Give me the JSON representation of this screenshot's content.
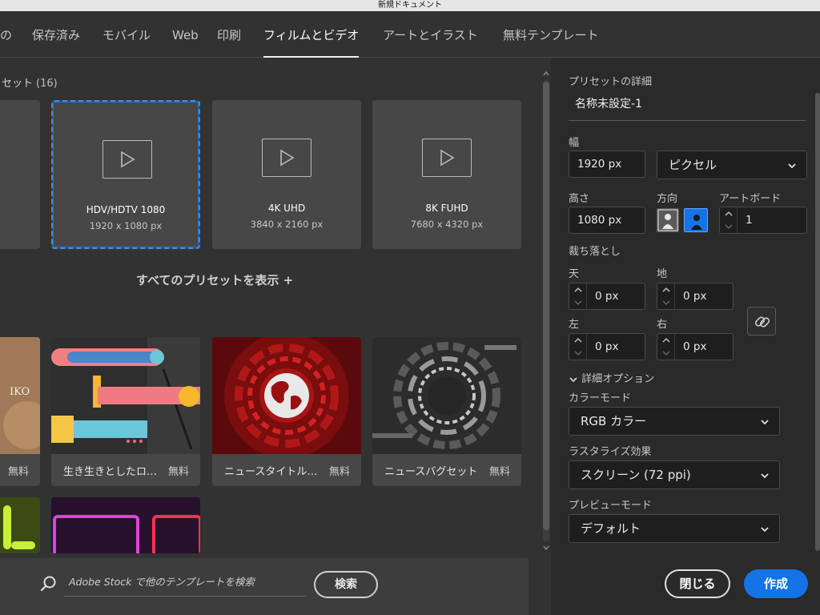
{
  "window": {
    "title": "新規ドキュメント"
  },
  "tabs": [
    {
      "label": "の"
    },
    {
      "label": "保存済み"
    },
    {
      "label": "モバイル"
    },
    {
      "label": "Web"
    },
    {
      "label": "印刷"
    },
    {
      "label": "フィルムとビデオ",
      "active": true
    },
    {
      "label": "アートとイラスト"
    },
    {
      "label": "無料テンプレート"
    }
  ],
  "presets_section": {
    "title": "セット",
    "count": "(16)"
  },
  "presets": [
    {
      "name": "HDV/HDTV 1080",
      "dims": "1920 x 1080 px",
      "selected": true,
      "icon": "video-play-icon"
    },
    {
      "name": "4K UHD",
      "dims": "3840 x 2160 px",
      "icon": "video-play-icon"
    },
    {
      "name": "8K FUHD",
      "dims": "7680 x 4320 px",
      "icon": "video-play-icon"
    }
  ],
  "show_all": "すべてのプリセットを表示 +",
  "templates": [
    {
      "name": "",
      "free": "無料"
    },
    {
      "name": "生き生きとしたロ…",
      "free": "無料"
    },
    {
      "name": "ニュースタイトル…",
      "free": "無料"
    },
    {
      "name": "ニュースバグセット",
      "free": "無料"
    }
  ],
  "search": {
    "placeholder": "Adobe Stock で他のテンプレートを検索",
    "button": "検索"
  },
  "details": {
    "heading": "プリセットの詳細",
    "name": "名称未設定-1",
    "width_label": "幅",
    "width_value": "1920 px",
    "unit": "ピクセル",
    "height_label": "高さ",
    "height_value": "1080 px",
    "orientation_label": "方向",
    "artboard_label": "アートボード",
    "artboard_value": "1",
    "bleed_label": "裁ち落とし",
    "top_label": "天",
    "top_value": "0 px",
    "bottom_label": "地",
    "bottom_value": "0 px",
    "left_label": "左",
    "left_value": "0 px",
    "right_label": "右",
    "right_value": "0 px",
    "advanced_label": "詳細オプション",
    "color_mode_label": "カラーモード",
    "color_mode_value": "RGB カラー",
    "raster_label": "ラスタライズ効果",
    "raster_value": "スクリーン (72 ppi)",
    "preview_label": "プレビューモード",
    "preview_value": "デフォルト"
  },
  "buttons": {
    "close": "閉じる",
    "create": "作成"
  },
  "colors": {
    "accent": "#1473e6",
    "panel": "#2a2a2a",
    "bg": "#323232"
  }
}
